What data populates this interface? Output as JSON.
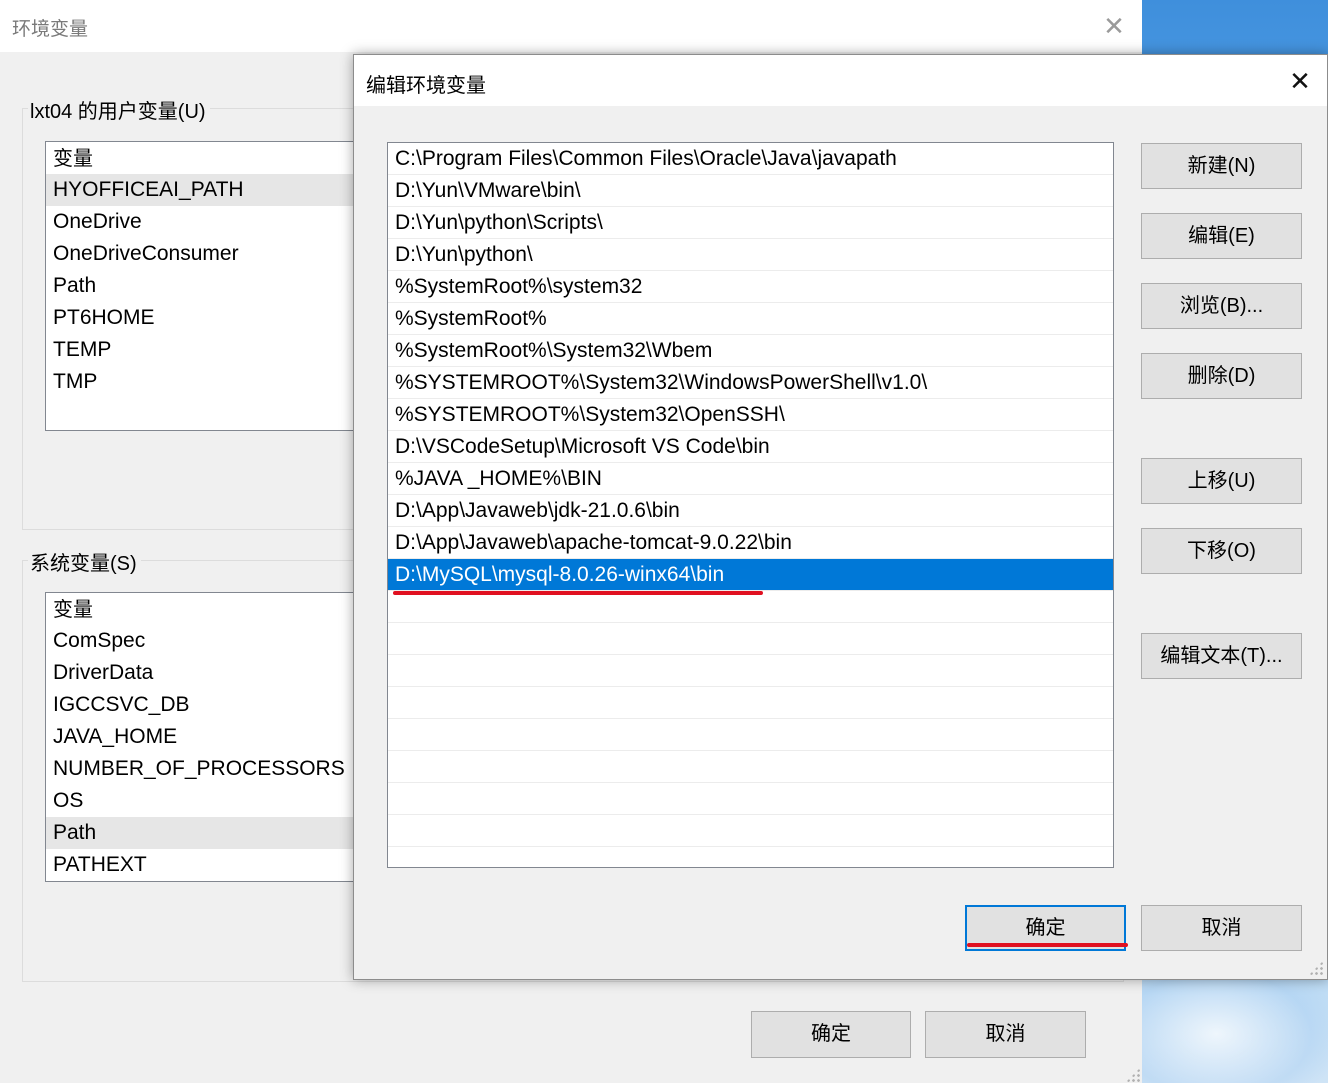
{
  "env_window": {
    "title": "环境变量",
    "close_label": "✕",
    "user_vars_label": "lxt04 的用户变量(U)",
    "user_vars_header": "变量",
    "user_vars": [
      "HYOFFICEAI_PATH",
      "OneDrive",
      "OneDriveConsumer",
      "Path",
      "PT6HOME",
      "TEMP",
      "TMP"
    ],
    "system_vars_label": "系统变量(S)",
    "system_vars_header": "变量",
    "system_vars": [
      "ComSpec",
      "DriverData",
      "IGCCSVC_DB",
      "JAVA_HOME",
      "NUMBER_OF_PROCESSORS",
      "OS",
      "Path",
      "PATHEXT"
    ],
    "ok_label": "确定",
    "cancel_label": "取消"
  },
  "edit_dialog": {
    "title": "编辑环境变量",
    "close_label": "✕",
    "paths": [
      "C:\\Program Files\\Common Files\\Oracle\\Java\\javapath",
      "D:\\Yun\\VMware\\bin\\",
      "D:\\Yun\\python\\Scripts\\",
      "D:\\Yun\\python\\",
      "%SystemRoot%\\system32",
      "%SystemRoot%",
      "%SystemRoot%\\System32\\Wbem",
      "%SYSTEMROOT%\\System32\\WindowsPowerShell\\v1.0\\",
      "%SYSTEMROOT%\\System32\\OpenSSH\\",
      "D:\\VSCodeSetup\\Microsoft VS Code\\bin",
      "%JAVA _HOME%\\BIN",
      "D:\\App\\Javaweb\\jdk-21.0.6\\bin",
      "D:\\App\\Javaweb\\apache-tomcat-9.0.22\\bin",
      "D:\\MySQL\\mysql-8.0.26-winx64\\bin"
    ],
    "buttons": {
      "new": "新建(N)",
      "edit": "编辑(E)",
      "browse": "浏览(B)...",
      "delete": "删除(D)",
      "move_up": "上移(U)",
      "move_down": "下移(O)",
      "edit_text": "编辑文本(T)..."
    },
    "ok_label": "确定",
    "cancel_label": "取消"
  },
  "colors": {
    "selection": "#0078d7",
    "annotation_red": "#e01020"
  }
}
